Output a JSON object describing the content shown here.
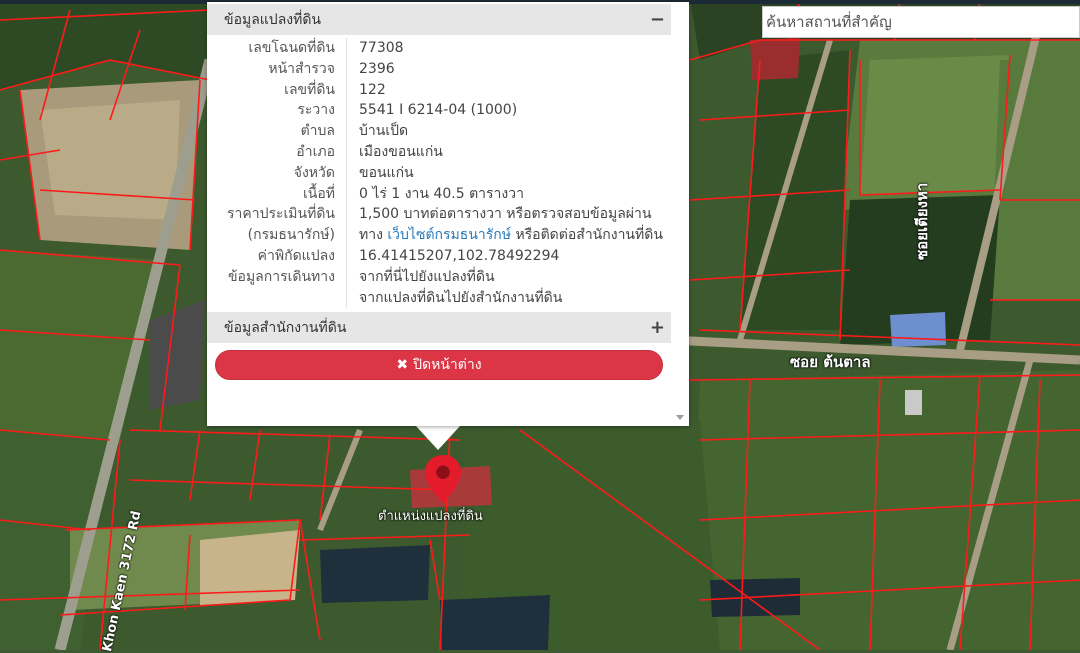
{
  "search": {
    "placeholder": "ค้นหาสถานที่สำคัญ"
  },
  "popup": {
    "parcel_header": "ข้อมูลแปลงที่ดิน",
    "parcel_header_icon": "minus-icon",
    "office_header": "ข้อมูลสำนักงานที่ดิน",
    "office_header_icon": "plus-icon",
    "rows": [
      {
        "label": "เลขโฉนดที่ดิน",
        "value": "77308"
      },
      {
        "label": "หน้าสำรวจ",
        "value": "2396"
      },
      {
        "label": "เลขที่ดิน",
        "value": "122"
      },
      {
        "label": "ระวาง",
        "value": "5541 I 6214-04 (1000)"
      },
      {
        "label": "ตำบล",
        "value": "บ้านเป็ด"
      },
      {
        "label": "อำเภอ",
        "value": "เมืองขอนแก่น"
      },
      {
        "label": "จังหวัด",
        "value": "ขอนแก่น"
      },
      {
        "label": "เนื้อที่",
        "value": "0 ไร่ 1 งาน 40.5 ตารางวา"
      }
    ],
    "appraisal_label_1": "ราคาประเมินที่ดิน",
    "appraisal_label_2": "(กรมธนารักษ์)",
    "appraisal_value_1": "1,500 บาทต่อตารางวา หรือตรวจสอบข้อมูลผ่าน",
    "appraisal_value_2_prefix": "ทาง",
    "appraisal_link": "เว็บไซต์กรมธนารักษ์",
    "appraisal_value_2_suffix": "หรือติดต่อสำนักงานที่ดิน",
    "coords_label": "ค่าพิกัดแปลง",
    "coords_value": "16.41415207,102.78492294",
    "travel_label": "ข้อมูลการเดินทาง",
    "travel_link_1": "จากที่นี่ไปยังแปลงที่ดิน",
    "travel_link_2": "จากแปลงที่ดินไปยังสำนักงานที่ดิน",
    "close_icon": "times-icon",
    "close_label": "ปิดหน้าต่าง"
  },
  "map": {
    "road_label_soi_tontan": "ซอย ต้นตาล",
    "road_label_soi_tiangha": "ซอยเตียงหา",
    "road_label_khon_kaen": "Khon Kaen 3172 Rd",
    "pin_label": "ตำแหน่งแปลงที่ดิน",
    "pin_icon": "map-marker-icon",
    "parcel_line_color": "#ff1a1a",
    "pin_color": "#e41b2b"
  }
}
